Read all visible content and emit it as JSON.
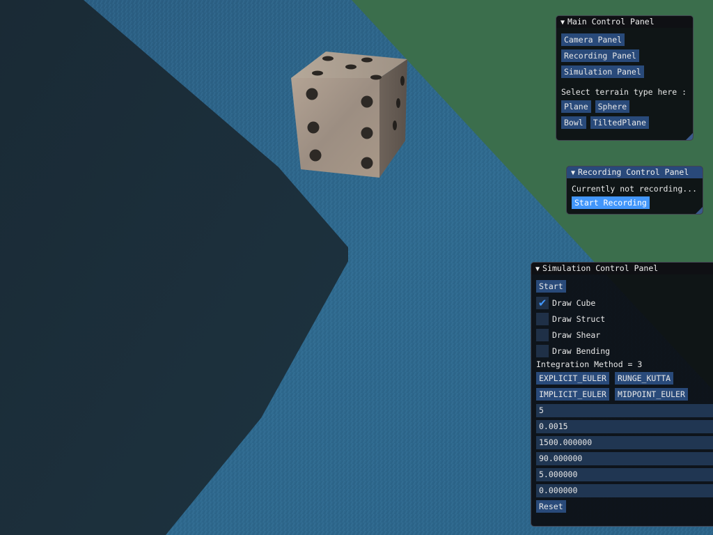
{
  "main_panel": {
    "title": "Main Control Panel",
    "buttons": {
      "camera": "Camera Panel",
      "recording": "Recording Panel",
      "simulation": "Simulation Panel"
    },
    "terrain_prompt": "Select terrain type here :",
    "terrain": {
      "plane": "Plane",
      "sphere": "Sphere",
      "bowl": "Bowl",
      "tilted": "TiltedPlane"
    }
  },
  "recording_panel": {
    "title": "Recording Control Panel",
    "status": "Currently not recording...",
    "start_button": "Start Recording"
  },
  "simulation_panel": {
    "title": "Simulation Control Panel",
    "start_button": "Start",
    "checkboxes": {
      "cube": {
        "label": "Draw Cube",
        "checked": true
      },
      "struct": {
        "label": "Draw Struct",
        "checked": false
      },
      "shear": {
        "label": "Draw Shear",
        "checked": false
      },
      "bending": {
        "label": "Draw Bending",
        "checked": false
      }
    },
    "integration_label": "Integration Method = 3",
    "methods": {
      "explicit_euler": "EXPLICIT_EULER",
      "runge_kutta": "RUNGE_KUTTA",
      "implicit_euler": "IMPLICIT_EULER",
      "midpoint_euler": "MIDPOINT_EULER"
    },
    "fields": [
      "5",
      "0.0015",
      "1500.000000",
      "90.000000",
      "5.000000",
      "0.000000"
    ],
    "reset_button": "Reset"
  },
  "colors": {
    "background_green": "#3b6e4c",
    "water_blue": "#2d6386",
    "dark_region": "#1b2e3a",
    "button_blue": "#294a7a",
    "button_hot": "#4296fa"
  },
  "icons": {
    "collapse": "triangle-down",
    "check": "check-mark"
  }
}
